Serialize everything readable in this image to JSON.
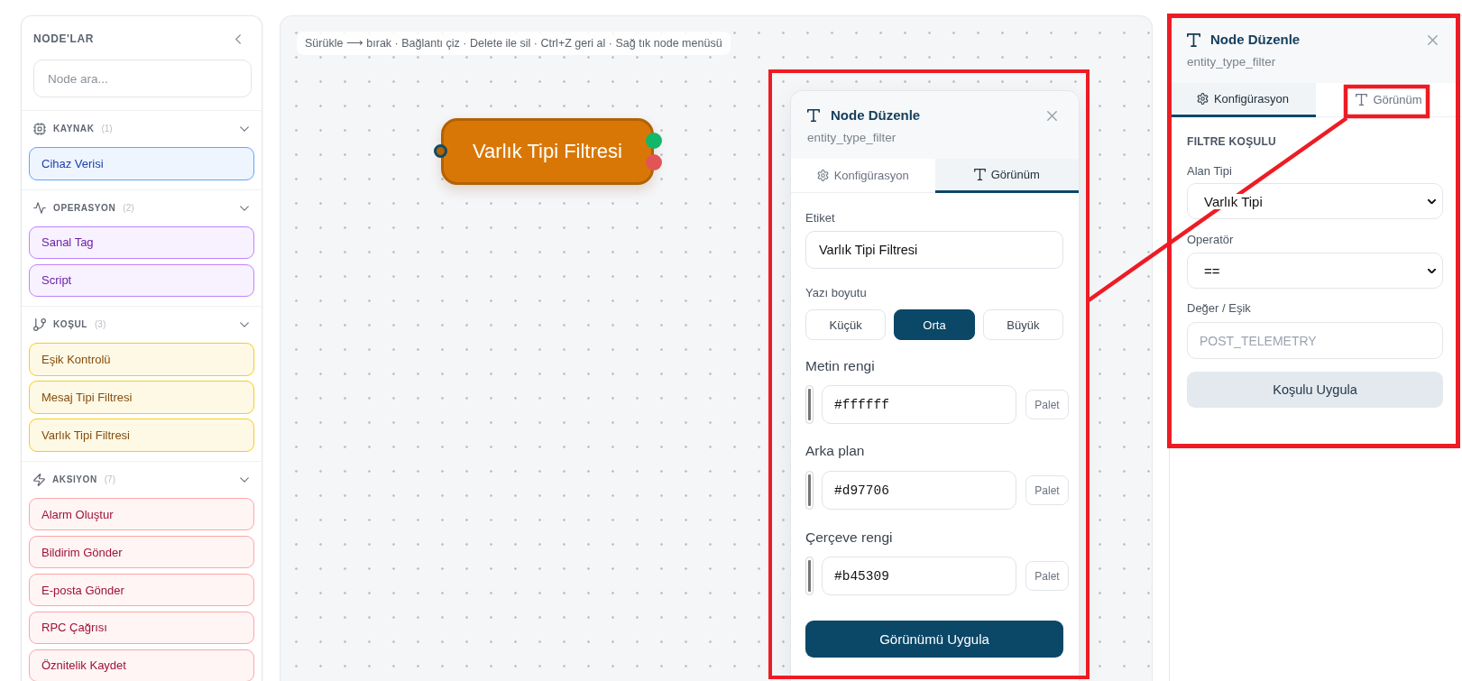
{
  "sidebar": {
    "title": "NODE'LAR",
    "search": {
      "placeholder": "Node ara..."
    },
    "groups": [
      {
        "kind": "source",
        "name": "KAYNAK",
        "count": "(1)",
        "expanded": true,
        "color": "#60a5fa",
        "items": [
          "Cihaz Verisi"
        ]
      },
      {
        "kind": "operation",
        "name": "OPERASYON",
        "count": "(2)",
        "expanded": true,
        "color": "#c084fc",
        "items": [
          "Sanal Tag",
          "Script"
        ]
      },
      {
        "kind": "condition",
        "name": "KOŞUL",
        "count": "(3)",
        "expanded": true,
        "color": "#facc15",
        "items": [
          "Eşik Kontrolü",
          "Mesaj Tipi Filtresi",
          "Varlık Tipi Filtresi"
        ]
      },
      {
        "kind": "action",
        "name": "AKSIYON",
        "count": "(7)",
        "expanded": true,
        "color": "#fca5a5",
        "items": [
          "Alarm Oluştur",
          "Bildirim Gönder",
          "E-posta Gönder",
          "RPC Çağrısı",
          "Öznitelik Kaydet"
        ]
      }
    ]
  },
  "canvas": {
    "hint": "Sürükle ⟶ bırak · Bağlantı çiz · Delete ile sil · Ctrl+Z geri al · Sağ tık node menüsü",
    "nodes": [
      {
        "label": "Varlık Tipi Filtresi",
        "color": "#d97706",
        "ports": [
          {
            "kind": "input",
            "color": "#0f4c68"
          },
          {
            "kind": "output",
            "color": "#12b76a"
          },
          {
            "kind": "output",
            "color": "#e25555"
          }
        ]
      }
    ]
  },
  "appearance_panel": {
    "highlighted": true,
    "title": "Node Düzenle",
    "subtitle": "entity_type_filter",
    "tabs": [
      {
        "kind": "configuration",
        "label": "Konfigürasyon",
        "selected": false
      },
      {
        "kind": "appearance",
        "label": "Görünüm",
        "selected": true
      }
    ],
    "label_field": {
      "label": "Etiket",
      "value": "Varlık Tipi Filtresi"
    },
    "font_size": {
      "label": "Yazı boyutu",
      "options": [
        {
          "label": "Küçük",
          "selected": false
        },
        {
          "label": "Orta",
          "selected": true
        },
        {
          "label": "Büyük",
          "selected": false
        }
      ]
    },
    "colors": [
      {
        "label": "Metin rengi",
        "value": "#ffffff",
        "button": "Palet"
      },
      {
        "label": "Arka plan",
        "value": "#d97706",
        "button": "Palet"
      },
      {
        "label": "Çerçeve rengi",
        "value": "#b45309",
        "button": "Palet"
      }
    ],
    "apply_button": "Görünümü Uygula"
  },
  "config_panel": {
    "highlighted": true,
    "title": "Node Düzenle",
    "subtitle": "entity_type_filter",
    "tabs": [
      {
        "kind": "configuration",
        "label": "Konfigürasyon",
        "selected": true,
        "highlighted": false
      },
      {
        "kind": "appearance",
        "label": "Görünüm",
        "selected": false,
        "highlighted": true
      }
    ],
    "section": "FILTRE KOŞULU",
    "fields": [
      {
        "kind": "select",
        "label": "Alan Tipi",
        "value": "Varlık Tipi"
      },
      {
        "kind": "select",
        "label": "Operatör",
        "value": "=="
      },
      {
        "kind": "text",
        "label": "Değer / Eşik",
        "placeholder": "POST_TELEMETRY"
      }
    ],
    "apply_button": "Koşulu Uygula"
  },
  "callout_line": true
}
